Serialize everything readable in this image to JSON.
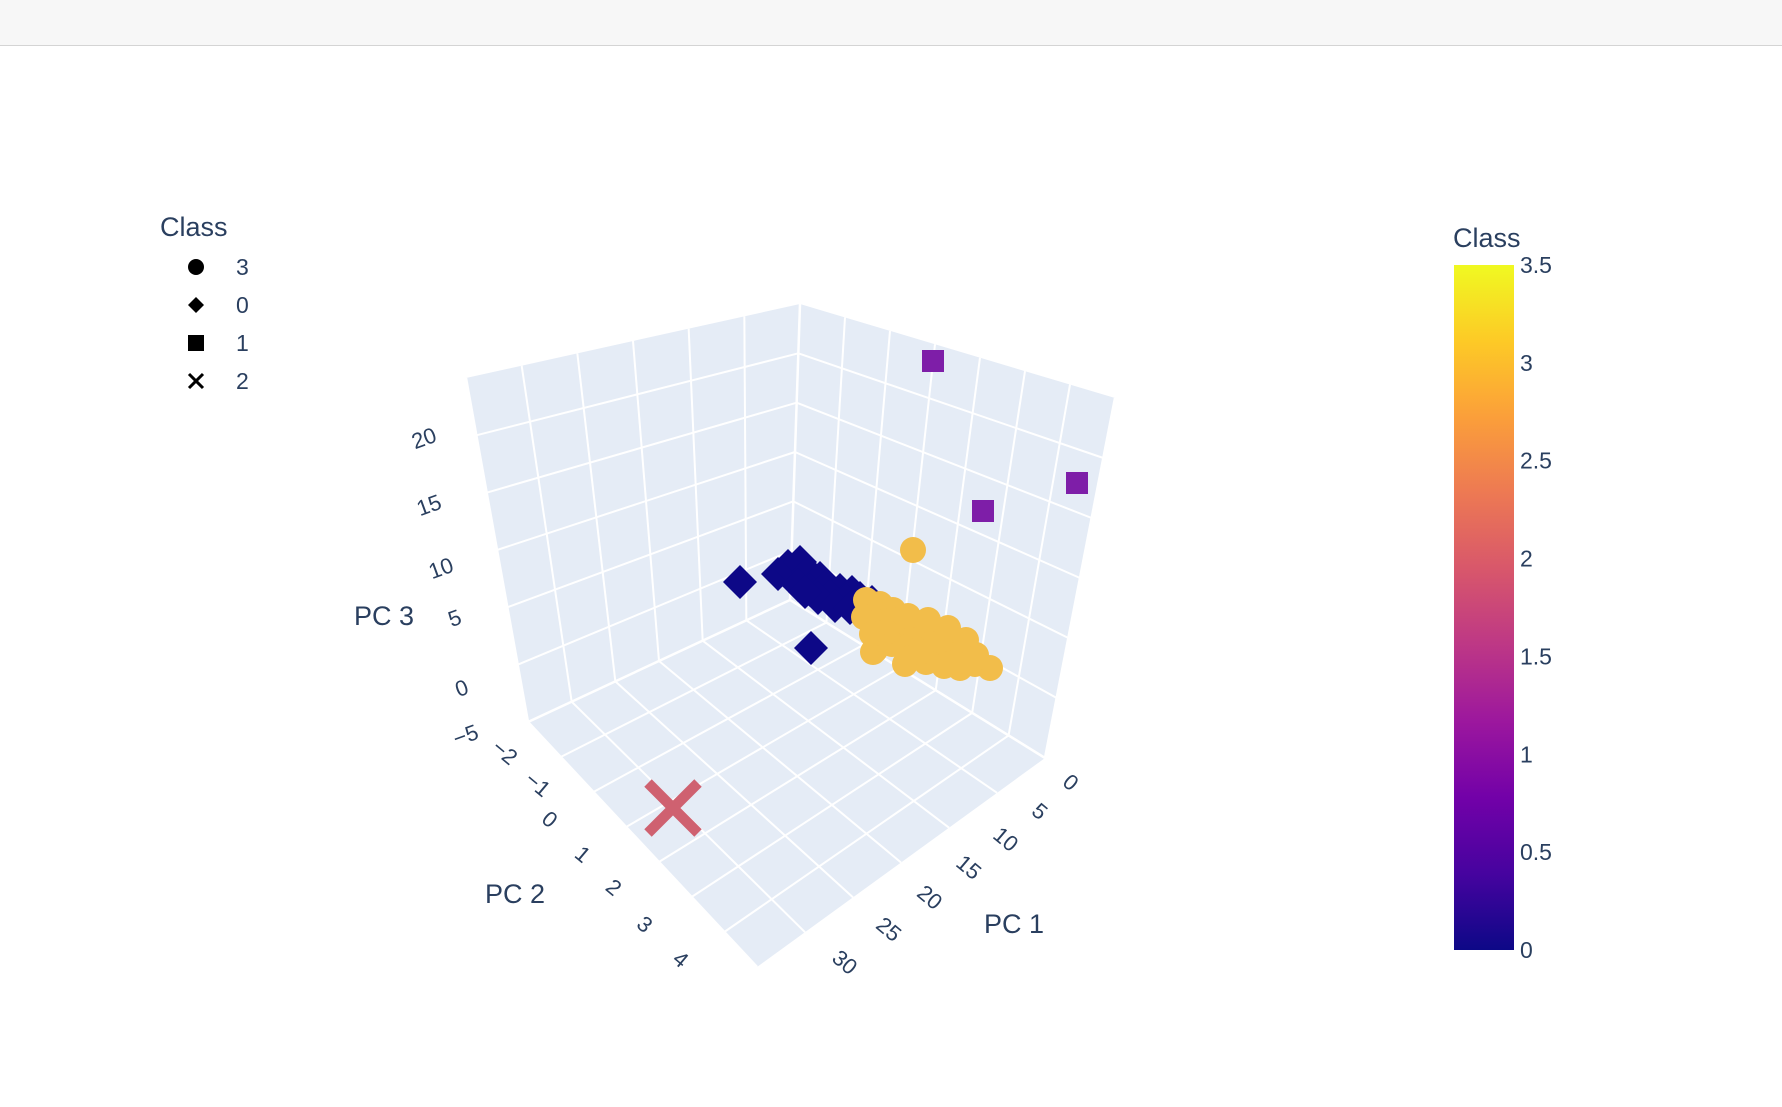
{
  "chart_data": {
    "type": "scatter3d",
    "scene": {
      "xaxis": {
        "title": "PC 1",
        "ticks": [
          "0",
          "5",
          "10",
          "15",
          "20",
          "25",
          "30"
        ]
      },
      "yaxis": {
        "title": "PC 2",
        "ticks": [
          "−2",
          "−1",
          "0",
          "1",
          "2",
          "3",
          "4"
        ]
      },
      "zaxis": {
        "title": "PC 3",
        "ticks": [
          "−5",
          "0",
          "5",
          "10",
          "15",
          "20"
        ]
      },
      "background": "#e5ecf6",
      "grid": true
    },
    "legend": {
      "title": "Class",
      "placement": "top-left",
      "items": [
        {
          "label": "3",
          "symbol": "circle"
        },
        {
          "label": "0",
          "symbol": "diamond"
        },
        {
          "label": "1",
          "symbol": "square"
        },
        {
          "label": "2",
          "symbol": "x"
        }
      ]
    },
    "colorbar": {
      "title": "Class",
      "range": [
        0,
        3.5
      ],
      "ticks": [
        "3.5",
        "3",
        "2.5",
        "2",
        "1.5",
        "1",
        "0.5",
        "0"
      ],
      "colorscale": [
        "#0d0887",
        "#46039f",
        "#7201a8",
        "#9c179e",
        "#bd3786",
        "#d8576b",
        "#ed7953",
        "#fb9f3a",
        "#fdca26",
        "#f0f921"
      ]
    },
    "series": [
      {
        "name": "3",
        "symbol": "circle",
        "color": "#f2bd4a"
      },
      {
        "name": "0",
        "symbol": "diamond",
        "color": "#0d0887"
      },
      {
        "name": "1",
        "symbol": "square",
        "color": "#7e1ea8"
      },
      {
        "name": "2",
        "symbol": "x",
        "color": "#cf6170"
      }
    ]
  }
}
